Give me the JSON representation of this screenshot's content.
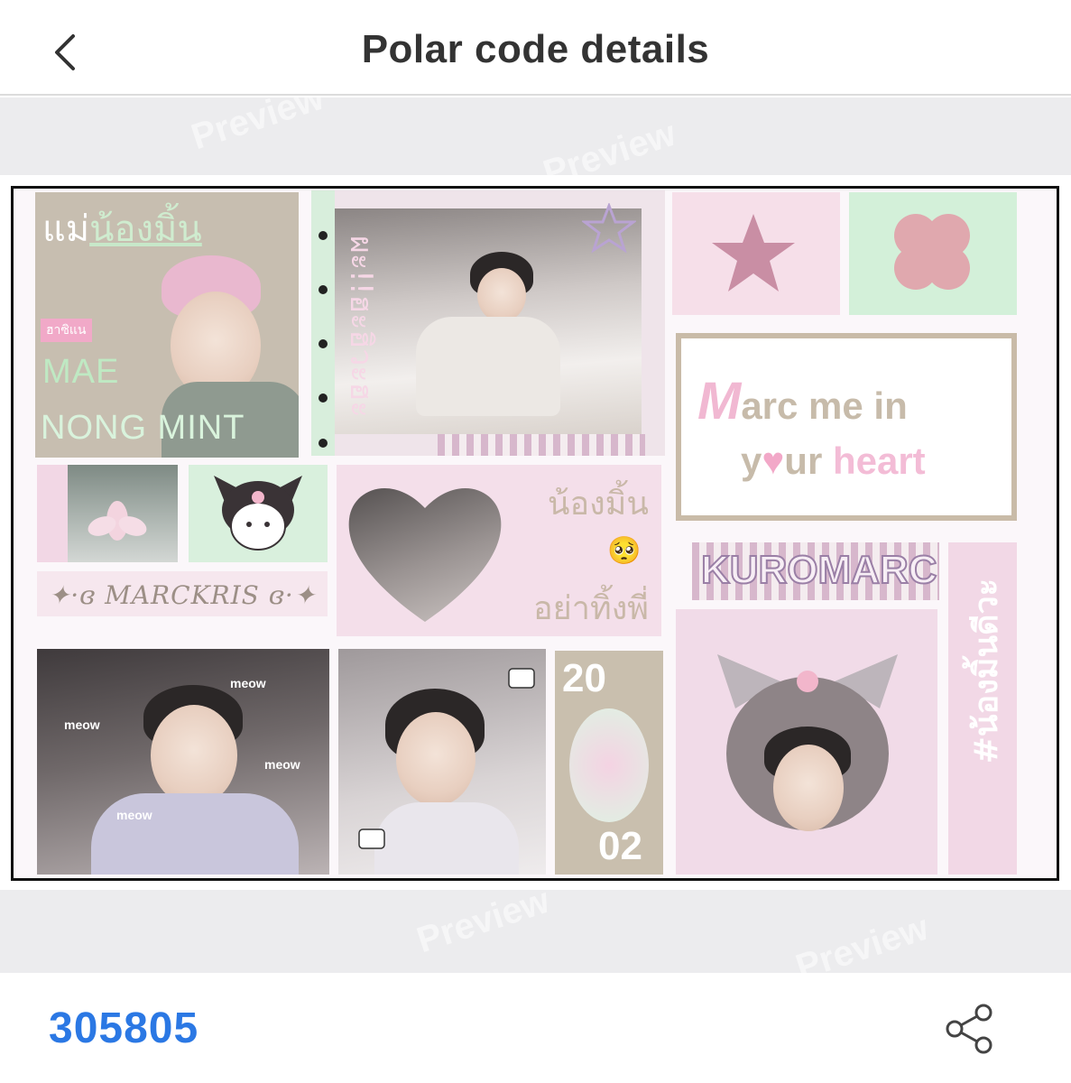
{
  "header": {
    "title": "Polar code details"
  },
  "preview": {
    "watermark": "Preview"
  },
  "card": {
    "mae_title_a": "แม่",
    "mae_title_b": "น้องมิ้น",
    "mae_tag": "ฮาซิแน",
    "mae_name_1": "MAE",
    "mae_name_2": "NONG MINT",
    "bed_vertical": "ผะ!!ฮะฮิวะฮะ",
    "marc_m": "M",
    "marc_line1": "arc me in",
    "marc_y": "y",
    "marc_heart": "♥",
    "marc_ur": "ur",
    "marc_heart_word": "heart",
    "heart_text_1": "น้องมิ้น",
    "heart_text_2": "อย่าทิ้งพี่",
    "heart_emoji": "🥺",
    "marckris": "✦·ɞ MARCKRIS ɞ·✦",
    "kuromarc": "KUROMARC",
    "hashtag": "#น้องมิ้นดีวะ",
    "meow_1": "meow",
    "meow_2": "meow",
    "meow_3": "meow",
    "meow_4": "meow",
    "num_top": "20",
    "num_bottom": "02"
  },
  "footer": {
    "code": "305805"
  },
  "icons": {
    "back": "chevron-left-icon",
    "share": "share-icon"
  }
}
